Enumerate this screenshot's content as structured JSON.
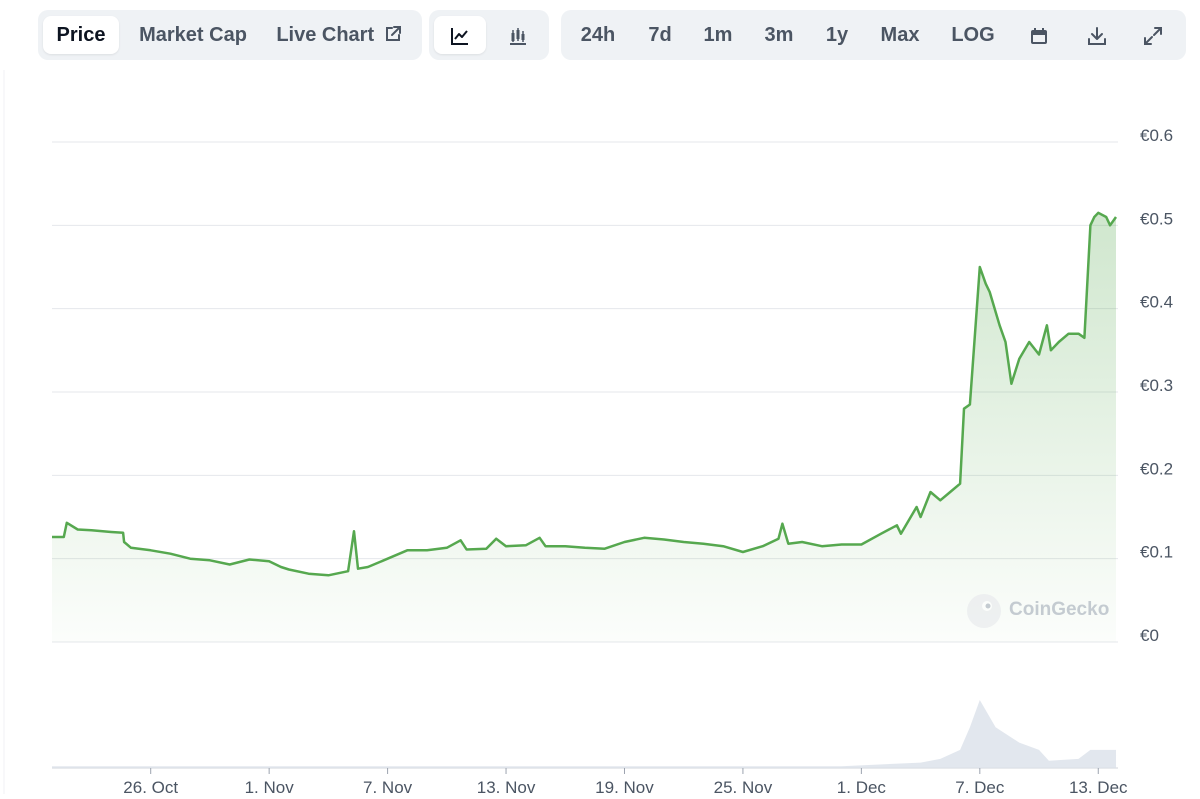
{
  "toolbar": {
    "tabs": [
      {
        "label": "Price",
        "active": true
      },
      {
        "label": "Market Cap",
        "active": false
      },
      {
        "label": "Live Chart",
        "active": false
      }
    ],
    "chart_types": [
      {
        "icon": "line-chart-icon",
        "active": true
      },
      {
        "icon": "candlestick-icon",
        "active": false
      }
    ],
    "ranges": [
      "24h",
      "7d",
      "1m",
      "3m",
      "1y",
      "Max",
      "LOG"
    ],
    "tools": [
      "calendar-icon",
      "download-icon",
      "expand-icon"
    ]
  },
  "watermark": "CoinGecko",
  "colors": {
    "line": "#56a84f",
    "grid": "#e5e7eb",
    "axis_text": "#4b5563",
    "volume": "#dbe1ea"
  },
  "chart_data": {
    "type": "line",
    "currency_prefix": "€",
    "ylim": [
      0,
      0.6
    ],
    "y_ticks": [
      {
        "value": 0,
        "label": "€0"
      },
      {
        "value": 0.1,
        "label": "€0.1"
      },
      {
        "value": 0.2,
        "label": "€0.2"
      },
      {
        "value": 0.3,
        "label": "€0.3"
      },
      {
        "value": 0.4,
        "label": "€0.4"
      },
      {
        "value": 0.5,
        "label": "€0.5"
      },
      {
        "value": 0.6,
        "label": "€0.6"
      }
    ],
    "x_range_days": [
      0,
      54
    ],
    "x_ticks": [
      {
        "day": 5,
        "label": "26. Oct"
      },
      {
        "day": 11,
        "label": "1. Nov"
      },
      {
        "day": 17,
        "label": "7. Nov"
      },
      {
        "day": 23,
        "label": "13. Nov"
      },
      {
        "day": 29,
        "label": "19. Nov"
      },
      {
        "day": 35,
        "label": "25. Nov"
      },
      {
        "day": 41,
        "label": "1. Dec"
      },
      {
        "day": 47,
        "label": "7. Dec"
      },
      {
        "day": 53,
        "label": "13. Dec"
      }
    ],
    "grid": true,
    "series": [
      {
        "values": [
          [
            0,
            0.126
          ],
          [
            0.6,
            0.126
          ],
          [
            0.75,
            0.143
          ],
          [
            1.3,
            0.135
          ],
          [
            2,
            0.134
          ],
          [
            3,
            0.132
          ],
          [
            3.6,
            0.131
          ],
          [
            3.65,
            0.12
          ],
          [
            4,
            0.113
          ],
          [
            5,
            0.11
          ],
          [
            6,
            0.106
          ],
          [
            7,
            0.1
          ],
          [
            8,
            0.098
          ],
          [
            9,
            0.093
          ],
          [
            10,
            0.099
          ],
          [
            11,
            0.097
          ],
          [
            11.6,
            0.09
          ],
          [
            12,
            0.087
          ],
          [
            13,
            0.082
          ],
          [
            14,
            0.08
          ],
          [
            15,
            0.085
          ],
          [
            15.3,
            0.133
          ],
          [
            15.5,
            0.088
          ],
          [
            16,
            0.09
          ],
          [
            17,
            0.1
          ],
          [
            18,
            0.11
          ],
          [
            19,
            0.11
          ],
          [
            20,
            0.113
          ],
          [
            20.7,
            0.122
          ],
          [
            21,
            0.111
          ],
          [
            22,
            0.112
          ],
          [
            22.5,
            0.124
          ],
          [
            23,
            0.115
          ],
          [
            24,
            0.116
          ],
          [
            24.7,
            0.125
          ],
          [
            25,
            0.115
          ],
          [
            26,
            0.115
          ],
          [
            27,
            0.113
          ],
          [
            28,
            0.112
          ],
          [
            29,
            0.12
          ],
          [
            30,
            0.125
          ],
          [
            31,
            0.123
          ],
          [
            32,
            0.12
          ],
          [
            33,
            0.118
          ],
          [
            34,
            0.115
          ],
          [
            35,
            0.108
          ],
          [
            36,
            0.115
          ],
          [
            36.8,
            0.124
          ],
          [
            37,
            0.142
          ],
          [
            37.3,
            0.118
          ],
          [
            38,
            0.12
          ],
          [
            39,
            0.115
          ],
          [
            40,
            0.117
          ],
          [
            41,
            0.117
          ],
          [
            42,
            0.13
          ],
          [
            42.8,
            0.14
          ],
          [
            43,
            0.13
          ],
          [
            43.8,
            0.162
          ],
          [
            44,
            0.15
          ],
          [
            44.5,
            0.18
          ],
          [
            45,
            0.17
          ],
          [
            45.5,
            0.18
          ],
          [
            46,
            0.19
          ],
          [
            46.2,
            0.28
          ],
          [
            46.5,
            0.285
          ],
          [
            47,
            0.45
          ],
          [
            47.3,
            0.43
          ],
          [
            47.5,
            0.42
          ],
          [
            48,
            0.38
          ],
          [
            48.3,
            0.36
          ],
          [
            48.6,
            0.31
          ],
          [
            49,
            0.34
          ],
          [
            49.5,
            0.36
          ],
          [
            50,
            0.345
          ],
          [
            50.4,
            0.38
          ],
          [
            50.6,
            0.35
          ],
          [
            51,
            0.36
          ],
          [
            51.5,
            0.37
          ],
          [
            52,
            0.37
          ],
          [
            52.3,
            0.365
          ],
          [
            52.6,
            0.5
          ],
          [
            52.8,
            0.51
          ],
          [
            53,
            0.515
          ],
          [
            53.4,
            0.51
          ],
          [
            53.6,
            0.5
          ],
          [
            53.9,
            0.51
          ]
        ]
      }
    ],
    "volume": [
      [
        0,
        0.002
      ],
      [
        10,
        0.002
      ],
      [
        20,
        0.002
      ],
      [
        30,
        0.002
      ],
      [
        40,
        0.002
      ],
      [
        44,
        0.006
      ],
      [
        45,
        0.01
      ],
      [
        46,
        0.02
      ],
      [
        46.5,
        0.045
      ],
      [
        47,
        0.075
      ],
      [
        47.4,
        0.06
      ],
      [
        47.8,
        0.045
      ],
      [
        48.5,
        0.035
      ],
      [
        49,
        0.028
      ],
      [
        50,
        0.02
      ],
      [
        50.5,
        0.008
      ],
      [
        52,
        0.01
      ],
      [
        52.6,
        0.02
      ],
      [
        53.9,
        0.02
      ]
    ]
  }
}
